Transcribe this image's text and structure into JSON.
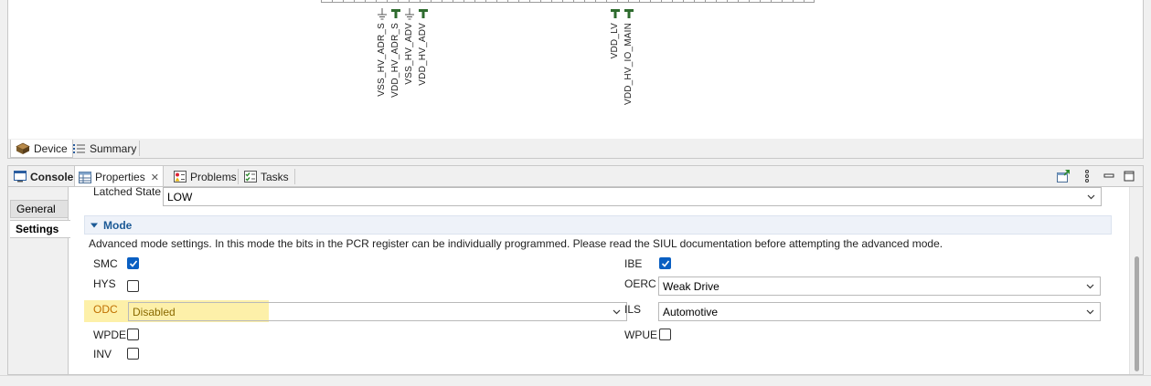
{
  "diagram": {
    "pins": [
      {
        "label": "VSS_HV_ADR_S",
        "symbol": "ground-icon"
      },
      {
        "label": "VDD_HV_ADR_S",
        "symbol": "power-tee-icon"
      },
      {
        "label": "VSS_HV_ADV",
        "symbol": "ground-icon"
      },
      {
        "label": "VDD_HV_ADV",
        "symbol": "power-tee-icon"
      },
      {
        "label": "VDD_LV",
        "symbol": "power-tee-icon"
      },
      {
        "label": "VDD_HV_IO_MAIN",
        "symbol": "power-tee-icon"
      }
    ]
  },
  "editor_tabs": [
    {
      "label": "Device",
      "icon": "chip-icon",
      "active": true
    },
    {
      "label": "Summary",
      "icon": "list-icon",
      "active": false
    }
  ],
  "view_tabs": [
    {
      "label": "Console",
      "icon": "console-icon",
      "active": false
    },
    {
      "label": "Properties",
      "icon": "properties-icon",
      "active": true,
      "close": "✕"
    },
    {
      "label": "Problems",
      "icon": "problems-icon",
      "active": false
    },
    {
      "label": "Tasks",
      "icon": "tasks-icon",
      "active": false
    }
  ],
  "side_tabs": [
    {
      "label": "General"
    },
    {
      "label": "Settings"
    }
  ],
  "latched_state": {
    "label": "Latched State",
    "value": "LOW"
  },
  "mode": {
    "title": "Mode",
    "description": "Advanced mode settings. In this mode the bits in the PCR register can be individually programmed. Please read the SIUL documentation before attempting the advanced mode.",
    "left": {
      "smc": {
        "label": "SMC",
        "checked": true
      },
      "hys": {
        "label": "HYS",
        "checked": false
      },
      "odc": {
        "label": "ODC",
        "value": "Disabled"
      },
      "wpde": {
        "label": "WPDE",
        "checked": false
      },
      "inv": {
        "label": "INV",
        "checked": false
      }
    },
    "right": {
      "ibe": {
        "label": "IBE",
        "checked": true
      },
      "oerc": {
        "label": "OERC",
        "value": "Weak Drive"
      },
      "ils": {
        "label": "ILS",
        "value": "Automotive"
      },
      "wpue": {
        "label": "WPUE",
        "checked": false
      }
    }
  },
  "colors": {
    "accent": "#0a5fc2",
    "section_title": "#1c5a96",
    "highlight": "#fdeea0"
  }
}
